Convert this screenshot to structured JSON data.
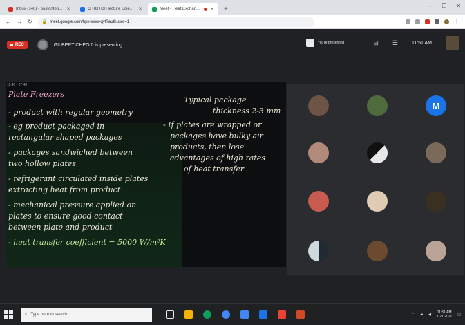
{
  "browser": {
    "tabs": [
      {
        "title": "Inbox (140) - bostonfoodie...",
        "favicon_color": "#d93025",
        "active": false
      },
      {
        "title": "G ROTCH lecture Science 2 ...",
        "favicon_color": "#1a73e8",
        "active": false
      },
      {
        "title": "Meet - Heat Exchange...",
        "favicon_color": "#0f9d58",
        "active": true
      }
    ],
    "new_tab_icon": "plus-icon",
    "url": "meet.google.com/hpx-xxxx-qyt?authuser=1",
    "window_controls": [
      "minimize-icon",
      "maximize-icon",
      "close-icon"
    ]
  },
  "meet": {
    "rec_label": "REC",
    "presenting_text": "GILBERT CHEO 0 is presenting",
    "you_presenting_label": "You're presenting",
    "time": "11:51 AM"
  },
  "board": {
    "timestamp": "11:46 - 07:48",
    "lines": [
      {
        "text": "Plate Freezers",
        "color": "pink",
        "underline": true
      },
      {
        "text": "- product with regular geometry",
        "color": "white"
      },
      {
        "text": "- eg product packaged in",
        "color": "white"
      },
      {
        "text": "  rectangular shaped packages",
        "color": "white"
      },
      {
        "text": "- packages sandwiched between",
        "color": "white"
      },
      {
        "text": "  two hollow plates",
        "color": "white"
      },
      {
        "text": "- refrigerant circulated inside plates",
        "color": "white"
      },
      {
        "text": "  extracting heat from product",
        "color": "white"
      },
      {
        "text": "- mechanical pressure applied on",
        "color": "white"
      },
      {
        "text": "  plates to ensure good contact",
        "color": "white"
      },
      {
        "text": "  between plate and product",
        "color": "white"
      },
      {
        "text": "- heat transfer coefficient = 5000 W/m²K",
        "color": "green"
      }
    ],
    "right_lines": [
      {
        "text": "Typical package",
        "color": "white"
      },
      {
        "text": "thickness 2-3 mm",
        "color": "white"
      },
      {
        "text": "- If plates are wrapped or",
        "color": "white"
      },
      {
        "text": "packages have bulky air",
        "color": "white"
      },
      {
        "text": "products, then lose",
        "color": "white"
      },
      {
        "text": "advantages of high rates",
        "color": "white"
      },
      {
        "text": "of heat transfer",
        "color": "white"
      }
    ]
  },
  "participants": [
    {
      "initial": "",
      "color": "#6d5447"
    },
    {
      "initial": "",
      "color": "#4f6b3d"
    },
    {
      "initial": "M",
      "color": "#1a73e8"
    },
    {
      "initial": "",
      "color": "#b28a7a"
    },
    {
      "initial": "",
      "color": "#e8e8e8"
    },
    {
      "initial": "",
      "color": "#7a6a5a"
    },
    {
      "initial": "",
      "color": "#c75b4f"
    },
    {
      "initial": "",
      "color": "#e0cbb5"
    },
    {
      "initial": "",
      "color": "#3a3020"
    },
    {
      "initial": "",
      "color": "#cfd8dc"
    },
    {
      "initial": "",
      "color": "#6b4a30"
    },
    {
      "initial": "",
      "color": "#b9a497"
    }
  ],
  "taskbar": {
    "search_placeholder": "Type here to search",
    "pinned_apps": [
      {
        "name": "task-view",
        "color": "#e8eaed"
      },
      {
        "name": "file-explorer",
        "color": "#f4b400"
      },
      {
        "name": "edge",
        "color": "#0f9d58"
      },
      {
        "name": "chrome",
        "color": "#4285f4"
      },
      {
        "name": "mail",
        "color": "#4285f4"
      },
      {
        "name": "store",
        "color": "#1a73e8"
      },
      {
        "name": "photos",
        "color": "#ea4335"
      },
      {
        "name": "powerpoint",
        "color": "#d24726"
      }
    ],
    "clock_time": "11:51 AM",
    "clock_date": "1/27/2021"
  }
}
